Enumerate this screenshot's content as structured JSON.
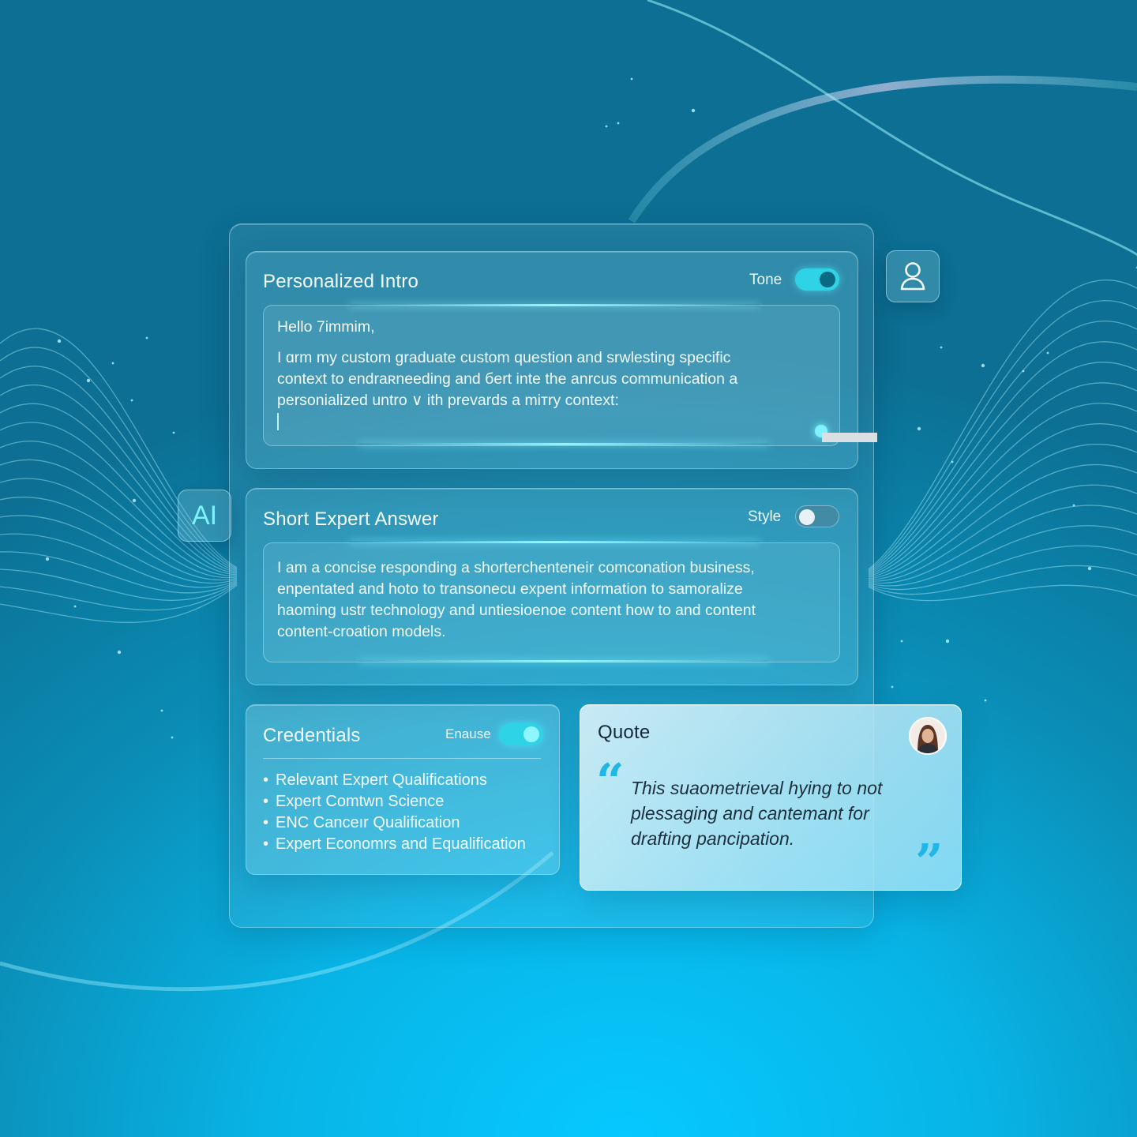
{
  "ai_badge": {
    "label": "AI"
  },
  "intro_card": {
    "title": "Personalized Intro",
    "toggle_label": "Tone",
    "toggle_on": true,
    "greeting": "Hello 7immim,",
    "body_lines": [
      "I ɑrm my custom graduate custom question and srwlesting specific",
      "context to endraʀneeding and бert inte the anrcus communication a",
      "personialized untro ∨ ith prevards a miтry context:"
    ]
  },
  "expert_card": {
    "title": "Short Expert Answer",
    "toggle_label": "Style",
    "toggle_on": false,
    "body_lines": [
      "I am a concise responding a shorterchenteneir comconation business,",
      "enpentated and hoto to transonecu expent information to samoralize",
      "haoming ustr technology and untiesioenoe content how to and content",
      "content-croation models."
    ]
  },
  "credentials_card": {
    "title": "Credentials",
    "toggle_label": "Enause",
    "toggle_on": true,
    "items": [
      "Relevant Expert Qualifications",
      "Expert Comtwn Science",
      "ENC Canceır Qualification",
      "Expert Economrs and Equalification"
    ]
  },
  "quote_card": {
    "title": "Quote",
    "open_mark": "“",
    "close_mark": "”",
    "text_lines": [
      "This suaometrieval hying to not",
      "plessaging and cantemant for",
      "drafting pancipation."
    ]
  },
  "icons": {
    "user": "user-icon",
    "avatar": "avatar"
  },
  "colors": {
    "accent": "#2fd3e6",
    "quote_mark": "#22b6e6",
    "background_top": "#0c6f93",
    "background_bottom": "#06c9ff"
  }
}
